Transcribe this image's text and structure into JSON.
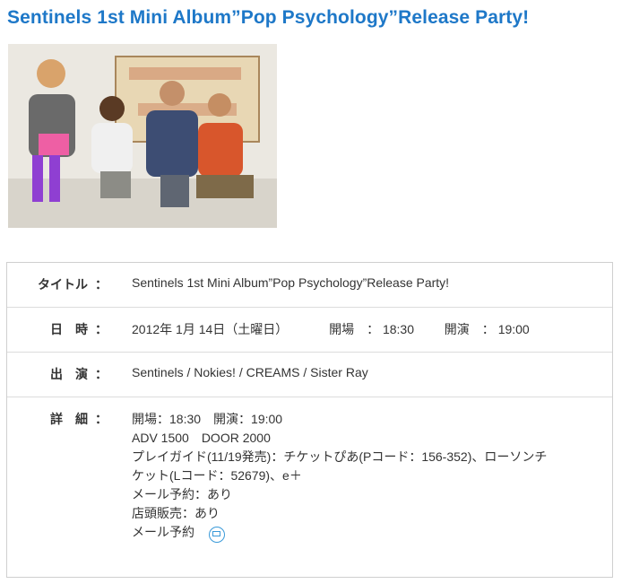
{
  "page_title": "Sentinels 1st Mini Album”Pop Psychology”Release Party!",
  "photo": {
    "alt": "band photo",
    "icon": "band-photo"
  },
  "info": {
    "title": {
      "label": "タイトル",
      "colon": "：",
      "value": "Sentinels 1st Mini Album”Pop Psychology”Release Party!"
    },
    "datetime": {
      "label": "日　時",
      "colon": "：",
      "date": "2012年 1月 14日（土曜日）",
      "open_label": "開場　：",
      "open_time": "18:30",
      "start_label": "開演　：",
      "start_time": "19:00"
    },
    "performers": {
      "label": "出　演",
      "colon": "：",
      "value": "Sentinels / Nokies! / CREAMS / Sister Ray"
    },
    "details": {
      "label": "詳　細",
      "colon": "：",
      "lines": [
        "開場：18:30　開演：19:00",
        "ADV 1500　DOOR 2000",
        "プレイガイド(11/19発売)：チケットぴあ(Pコード：156-352)、ローソンチ",
        "ケット(Lコード：52679)、e＋",
        "メール予約：あり",
        "店頭販売：あり"
      ],
      "mail_reserve": "メール予約",
      "mail_icon": "mail-icon"
    }
  }
}
